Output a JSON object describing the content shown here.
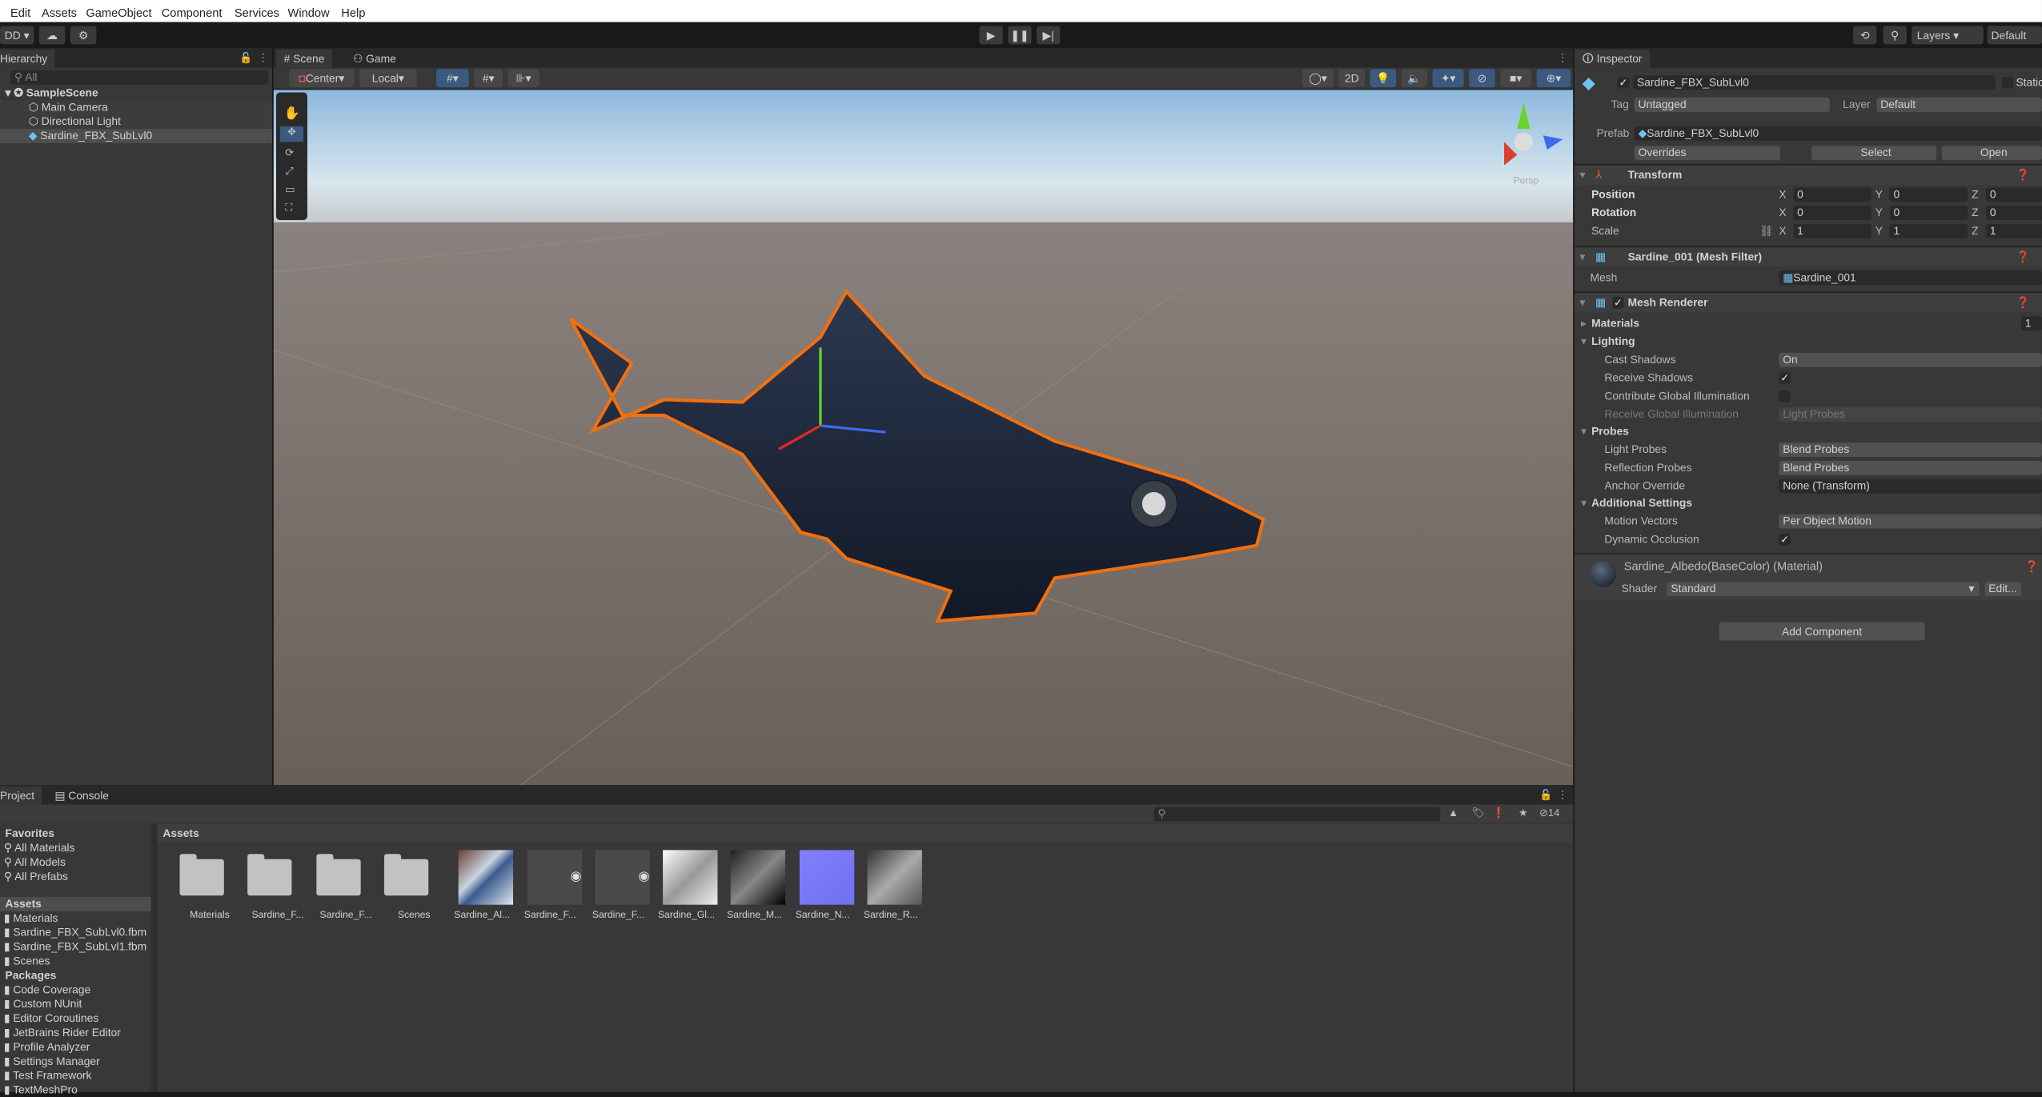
{
  "menu": [
    "Edit",
    "Assets",
    "GameObject",
    "Component",
    "Services",
    "Window",
    "Help"
  ],
  "toolbar": {
    "account": "DD ▾",
    "layers": "Layers",
    "layout": "Default"
  },
  "hierarchy": {
    "tab": "Hierarchy",
    "search_placeholder": "All",
    "scene": "SampleScene",
    "items": [
      "Main Camera",
      "Directional Light",
      "Sardine_FBX_SubLvl0"
    ]
  },
  "scene": {
    "tabs": [
      "Scene",
      "Game"
    ],
    "pivot": "Center",
    "space": "Local",
    "mode_2d": "2D",
    "gizmo_label": "Persp"
  },
  "inspector": {
    "tab": "Inspector",
    "name": "Sardine_FBX_SubLvl0",
    "static": "Static",
    "tag_label": "Tag",
    "tag": "Untagged",
    "layer_label": "Layer",
    "layer": "Default",
    "prefab_label": "Prefab",
    "prefab": "Sardine_FBX_SubLvl0",
    "overrides": "Overrides",
    "select": "Select",
    "open": "Open",
    "transform": {
      "title": "Transform",
      "rows": [
        {
          "label": "Position",
          "x": "0",
          "y": "0",
          "z": "0"
        },
        {
          "label": "Rotation",
          "x": "0",
          "y": "0",
          "z": "0"
        },
        {
          "label": "Scale",
          "x": "1",
          "y": "1",
          "z": "1"
        }
      ]
    },
    "mesh_filter": {
      "title": "Sardine_001 (Mesh Filter)",
      "mesh_label": "Mesh",
      "mesh": "Sardine_001"
    },
    "mesh_renderer": {
      "title": "Mesh Renderer",
      "materials": "Materials",
      "materials_count": "1",
      "lighting": "Lighting",
      "cast_shadows_label": "Cast Shadows",
      "cast_shadows": "On",
      "receive_shadows_label": "Receive Shadows",
      "receive_shadows": true,
      "contribute_gi_label": "Contribute Global Illumination",
      "contribute_gi": false,
      "receive_gi_label": "Receive Global Illumination",
      "receive_gi": "Light Probes",
      "probes": "Probes",
      "light_probes_label": "Light Probes",
      "light_probes": "Blend Probes",
      "reflection_probes_label": "Reflection Probes",
      "reflection_probes": "Blend Probes",
      "anchor_label": "Anchor Override",
      "anchor": "None (Transform)",
      "additional": "Additional Settings",
      "motion_label": "Motion Vectors",
      "motion": "Per Object Motion",
      "occlusion_label": "Dynamic Occlusion",
      "occlusion": true
    },
    "material": {
      "title": "Sardine_Albedo(BaseColor) (Material)",
      "shader_label": "Shader",
      "shader": "Standard",
      "edit": "Edit..."
    },
    "add_component": "Add Component"
  },
  "project": {
    "tabs": [
      "Project",
      "Console"
    ],
    "hidden_count": "14",
    "favorites": "Favorites",
    "fav_items": [
      "All Materials",
      "All Models",
      "All Prefabs"
    ],
    "assets_root": "Assets",
    "asset_folders": [
      "Materials",
      "Sardine_FBX_SubLvl0.fbm",
      "Sardine_FBX_SubLvl1.fbm",
      "Scenes"
    ],
    "packages": "Packages",
    "package_items": [
      "Code Coverage",
      "Custom NUnit",
      "Editor Coroutines",
      "JetBrains Rider Editor",
      "Profile Analyzer",
      "Settings Manager",
      "Test Framework",
      "TextMeshPro"
    ],
    "breadcrumb": "Assets",
    "grid": [
      "Materials",
      "Sardine_F...",
      "Sardine_F...",
      "Scenes",
      "Sardine_Al...",
      "Sardine_F...",
      "Sardine_F...",
      "Sardine_Gl...",
      "Sardine_M...",
      "Sardine_N...",
      "Sardine_R..."
    ]
  },
  "colors": {
    "accent": "#3a5a80",
    "selection_outline": "#f07010",
    "panel": "#383838"
  }
}
